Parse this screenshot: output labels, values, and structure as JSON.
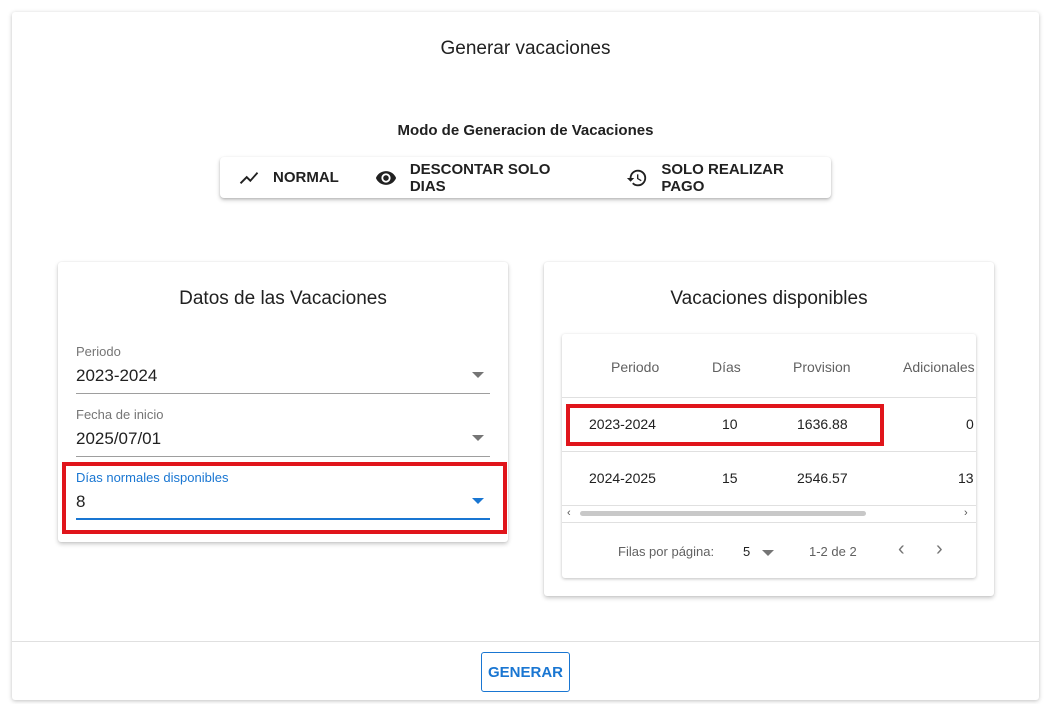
{
  "dialog": {
    "title": "Generar vacaciones",
    "mode_title": "Modo de Generacion de Vacaciones",
    "modes": [
      {
        "label": "NORMAL",
        "icon": "trending-up-icon"
      },
      {
        "label": "DESCONTAR SOLO DIAS",
        "icon": "eye-icon"
      },
      {
        "label": "SOLO REALIZAR PAGO",
        "icon": "restore-icon"
      }
    ],
    "generate_label": "GENERAR"
  },
  "datos": {
    "title": "Datos de las Vacaciones",
    "fields": [
      {
        "label": "Periodo",
        "value": "2023-2024"
      },
      {
        "label": "Fecha de inicio",
        "value": "2025/07/01"
      },
      {
        "label": "Días normales disponibles",
        "value": "8"
      }
    ]
  },
  "disponibles": {
    "title": "Vacaciones disponibles",
    "columns": [
      "Periodo",
      "Días",
      "Provision",
      "Adicionales"
    ],
    "rows": [
      {
        "periodo": "2023-2024",
        "dias": "10",
        "provision": "1636.88",
        "adicionales": "0"
      },
      {
        "periodo": "2024-2025",
        "dias": "15",
        "provision": "2546.57",
        "adicionales": "13"
      }
    ],
    "footer": {
      "rows_per_page_label": "Filas por página:",
      "rows_per_page_value": "5",
      "range": "1-2 de 2"
    }
  },
  "colors": {
    "accent": "#1976d2",
    "highlight": "#e0151b"
  }
}
